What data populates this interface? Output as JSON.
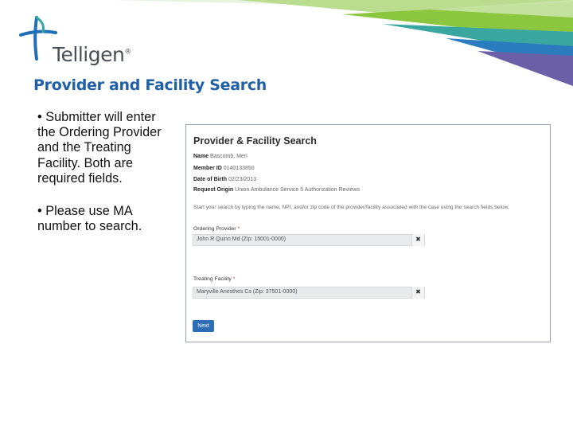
{
  "brand": {
    "name": "Telligen",
    "reg_mark": "®"
  },
  "slide": {
    "title": "Provider and Facility Search",
    "bullets": [
      "• Submitter will enter the Ordering Provider and the Treating Facility. Both are required fields.",
      "• Please use MA number to search."
    ]
  },
  "form": {
    "title": "Provider & Facility Search",
    "info": [
      {
        "label": "Name",
        "value": "Bascomb, Meri"
      },
      {
        "label": "Member ID",
        "value": "0140133850"
      },
      {
        "label": "Date of Birth",
        "value": "02/23/2013"
      },
      {
        "label": "Request Origin",
        "value": "Union Ambulance Service 5 Authorization Reviews"
      }
    ],
    "instruction": "Start your search by typing the name, NPI, and/or zip code of the provider/facility associated with the case using the search fields below.",
    "ordering_provider": {
      "label": "Ordering Provider",
      "required_mark": "*",
      "value": "John R Quinn Md (Zip: 15001-0000)",
      "clear_icon": "✖"
    },
    "treating_facility": {
      "label": "Treating Facility",
      "required_mark": "*",
      "value": "Maryville Anesthes Cs (Zip: 37501-0000)",
      "clear_icon": "✖"
    },
    "next_label": "Next"
  },
  "colors": {
    "title_blue": "#1f5fa7",
    "button_blue": "#2d6db5",
    "ribbon_teal": "#3aa6a0",
    "ribbon_green": "#8cc63f",
    "ribbon_purple": "#6b5fa8",
    "ribbon_blue": "#2b7bbf"
  }
}
